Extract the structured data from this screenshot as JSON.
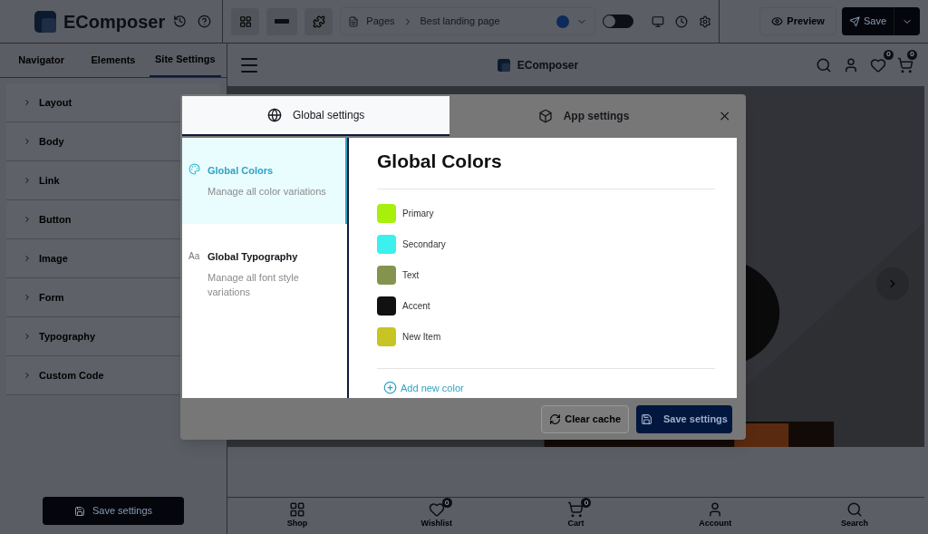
{
  "topbar": {
    "logo": "EComposer",
    "breadcrumb": {
      "section": "Pages",
      "page": "Best landing page"
    },
    "toggle": {
      "on": false
    },
    "preview": "Preview",
    "save": "Save"
  },
  "sidebar": {
    "tabs": [
      {
        "label": "Navigator",
        "selected": false
      },
      {
        "label": "Elements",
        "selected": false
      },
      {
        "label": "Site Settings",
        "selected": true
      }
    ],
    "items": [
      {
        "label": "Layout",
        "expanded": false
      },
      {
        "label": "Body",
        "expanded": false
      },
      {
        "label": "Link",
        "expanded": false
      },
      {
        "label": "Button",
        "expanded": false
      },
      {
        "label": "Image",
        "expanded": false
      },
      {
        "label": "Form",
        "expanded": false
      },
      {
        "label": "Typography",
        "expanded": false
      },
      {
        "label": "Custom Code",
        "expanded": false
      }
    ],
    "save_button": "Save settings"
  },
  "canvas": {
    "logo": "EComposer",
    "wishlist_count": "0",
    "cart_count": "0",
    "bottom_nav": [
      {
        "kind": "grid",
        "label": "Shop"
      },
      {
        "kind": "heart",
        "label": "Wishlist",
        "badge": "0"
      },
      {
        "kind": "cart",
        "label": "Cart",
        "badge": "0"
      },
      {
        "kind": "user",
        "label": "Account"
      },
      {
        "kind": "search",
        "label": "Search"
      }
    ]
  },
  "modal": {
    "tabs": [
      {
        "kind": "globe",
        "label": "Global settings",
        "selected": true
      },
      {
        "kind": "cube",
        "label": "App settings",
        "selected": false
      }
    ],
    "nav": [
      {
        "kind": "palette",
        "title": "Global Colors",
        "description": "Manage all color variations",
        "selected": true
      },
      {
        "kind": "type",
        "icon_text": "Aa",
        "title": "Global Typography",
        "description": "Manage all font style variations",
        "selected": false
      }
    ],
    "title": "Global Colors",
    "colors": [
      {
        "name": "Primary",
        "color": "#a6f00c"
      },
      {
        "name": "Secondary",
        "color": "#3cf0ee"
      },
      {
        "name": "Text",
        "color": "#84944f"
      },
      {
        "name": "Accent",
        "color": "#111111"
      },
      {
        "name": "New Item",
        "color": "#c8c424"
      }
    ],
    "add_color": "Add new color",
    "clear_cache": "Clear cache",
    "save_settings": "Save settings"
  }
}
